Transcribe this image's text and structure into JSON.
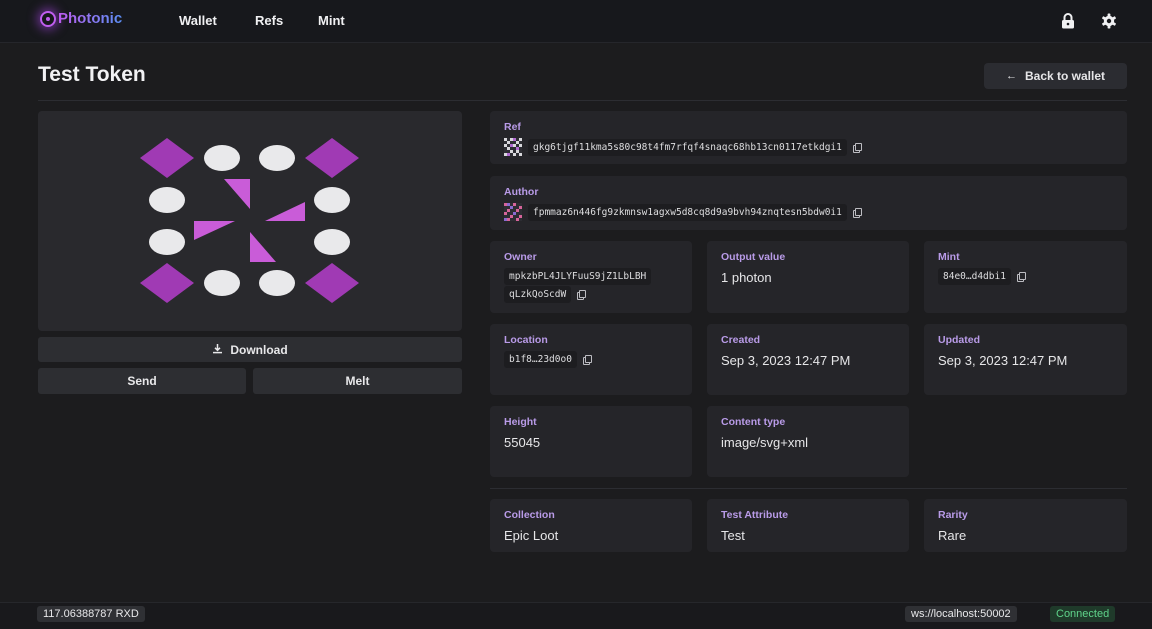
{
  "app": {
    "name": "Photonic"
  },
  "nav": [
    {
      "label": "Wallet"
    },
    {
      "label": "Refs"
    },
    {
      "label": "Mint"
    }
  ],
  "icons": {
    "lock": "lock-icon",
    "settings": "gear-icon",
    "copy": "copy-icon",
    "download": "download-icon",
    "back": "arrow-left-icon"
  },
  "page": {
    "title": "Test Token",
    "back_label": "Back to wallet"
  },
  "actions": {
    "download": "Download",
    "send": "Send",
    "melt": "Melt"
  },
  "details": {
    "ref": {
      "label": "Ref",
      "value": "gkg6tjgf11kma5s80c98t4fm7rfqf4snaqc68hb13cn0117etkdgi1"
    },
    "author": {
      "label": "Author",
      "value": "fpmmaz6n446fg9zkmnsw1agxw5d8cq8d9a9bvh94znqtesn5bdw0i1"
    },
    "owner": {
      "label": "Owner",
      "line1": "mpkzbPL4JLYFuuS9jZ1LbLBH",
      "line2": "qLzkQoScdW"
    },
    "output_value": {
      "label": "Output value",
      "value": "1 photon"
    },
    "mint": {
      "label": "Mint",
      "value": "84e0…d4dbi1"
    },
    "location": {
      "label": "Location",
      "value": "b1f8…23d0o0"
    },
    "created": {
      "label": "Created",
      "value": "Sep 3, 2023 12:47 PM"
    },
    "updated": {
      "label": "Updated",
      "value": "Sep 3, 2023 12:47 PM"
    },
    "height": {
      "label": "Height",
      "value": "55045"
    },
    "content_type": {
      "label": "Content type",
      "value": "image/svg+xml"
    }
  },
  "attributes": [
    {
      "label": "Collection",
      "value": "Epic Loot"
    },
    {
      "label": "Test Attribute",
      "value": "Test"
    },
    {
      "label": "Rarity",
      "value": "Rare"
    }
  ],
  "status": {
    "balance": "117.06388787 RXD",
    "ws": "ws://localhost:50002",
    "connection": "Connected"
  },
  "colors": {
    "accent": "#b99be8",
    "token_purple": "#a03ab4",
    "token_triangle": "#c95cd8",
    "connected": "#5fd38a"
  }
}
